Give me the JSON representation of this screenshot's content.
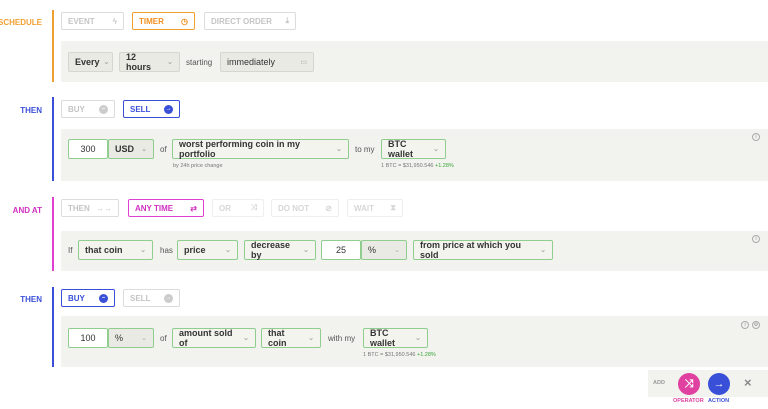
{
  "colors": {
    "orange": "#f0a030",
    "blue": "#3a4fd8",
    "pink": "#e040d0",
    "green": "#8fce8f"
  },
  "schedule": {
    "label": "SCHEDULE",
    "options": [
      {
        "label": "EVENT",
        "icon": "lightning-icon",
        "glyph": "ϟ"
      },
      {
        "label": "TIMER",
        "icon": "clock-icon",
        "glyph": "◷"
      },
      {
        "label": "DIRECT ORDER",
        "icon": "download-icon",
        "glyph": "⤓"
      }
    ],
    "every": "Every",
    "interval": "12 hours",
    "starting": "starting",
    "start_value": "immediately"
  },
  "then1": {
    "label": "THEN",
    "options": [
      {
        "label": "BUY",
        "icon": "buy-icon"
      },
      {
        "label": "SELL",
        "icon": "sell-icon"
      }
    ],
    "amount": "300",
    "currency": "USD",
    "of": "of",
    "target": "worst performing coin in my portfolio",
    "target_sub": "by 24h price change",
    "to_my": "to my",
    "wallet": "BTC wallet",
    "wallet_sub": "1 BTC = $31,950.546",
    "wallet_change": "+1.28%"
  },
  "andat": {
    "label": "AND AT",
    "options": [
      {
        "label": "THEN",
        "glyph": "→→"
      },
      {
        "label": "ANY TIME",
        "glyph": "⇄"
      },
      {
        "label": "OR",
        "glyph": "⤨"
      },
      {
        "label": "DO NOT",
        "glyph": "⊘"
      },
      {
        "label": "WAIT",
        "glyph": "⧗"
      }
    ],
    "if": "If",
    "subject": "that coin",
    "has": "has",
    "metric": "price",
    "change": "decrease by",
    "value": "25",
    "unit": "%",
    "reference": "from price at which you sold"
  },
  "then2": {
    "label": "THEN",
    "options": [
      {
        "label": "BUY",
        "icon": "buy-icon"
      },
      {
        "label": "SELL",
        "icon": "sell-icon"
      }
    ],
    "amount": "100",
    "unit": "%",
    "of": "of",
    "measure": "amount sold of",
    "subject": "that coin",
    "with_my": "with my",
    "wallet": "BTC wallet",
    "wallet_sub": "1 BTC = $31,950.546",
    "wallet_change": "+1.28%"
  },
  "footer": {
    "add": "ADD",
    "operator": "OPERATOR",
    "action": "ACTION",
    "close": "×"
  }
}
